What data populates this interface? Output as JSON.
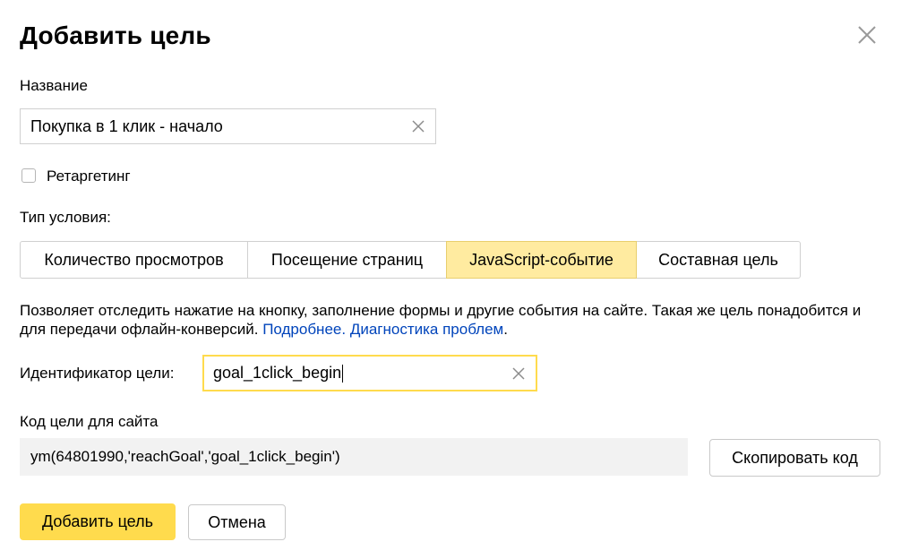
{
  "dialog": {
    "title": "Добавить цель"
  },
  "name_field": {
    "label": "Название",
    "value": "Покупка в 1 клик - начало"
  },
  "retargeting": {
    "label": "Ретаргетинг",
    "checked": false
  },
  "condition_type": {
    "label": "Тип условия:",
    "tabs": [
      {
        "label": "Количество просмотров",
        "active": false
      },
      {
        "label": "Посещение страниц",
        "active": false
      },
      {
        "label": "JavaScript-событие",
        "active": true
      },
      {
        "label": "Составная цель",
        "active": false
      }
    ]
  },
  "description": {
    "text": "Позволяет отследить нажатие на кнопку, заполнение формы и другие события на сайте. Такая же цель понадобится и для передачи офлайн-конверсий. ",
    "link_more": "Подробнее.",
    "link_diag": "Диагностика проблем",
    "tail": "."
  },
  "goal_id": {
    "label": "Идентификатор цели:",
    "value": "goal_1click_begin"
  },
  "site_code": {
    "label": "Код цели для сайта",
    "code": "ym(64801990,'reachGoal','goal_1click_begin')",
    "copy_label": "Скопировать код"
  },
  "actions": {
    "submit_label": "Добавить цель",
    "cancel_label": "Отмена"
  },
  "colors": {
    "accent": "#ffdb4d",
    "active_tab": "#ffeba0",
    "link": "#0044bb",
    "code_bg": "#f2f2f2"
  }
}
